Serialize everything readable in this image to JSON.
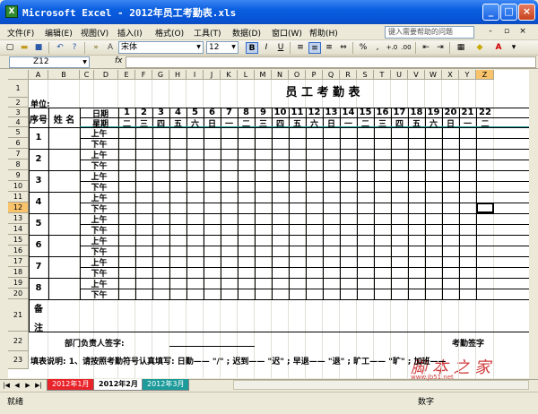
{
  "window": {
    "title": "Microsoft Excel - 2012年员工考勤表.xls",
    "app_icon": "X",
    "min": "_",
    "max": "□",
    "close": "×"
  },
  "menu": {
    "items": [
      "文件(F)",
      "编辑(E)",
      "视图(V)",
      "插入(I)",
      "格式(O)",
      "工具(T)",
      "数据(D)",
      "窗口(W)",
      "帮助(H)"
    ],
    "help_placeholder": "键入需要帮助的问题",
    "doc_controls": [
      "-",
      "▫",
      "×"
    ]
  },
  "toolbar": {
    "font": "宋体",
    "size": "12",
    "bold": "B",
    "italic": "I",
    "underline": "U",
    "percent": "%",
    "comma": ",",
    "font_color_glyph": "A"
  },
  "formula_bar": {
    "cell_ref": "Z12",
    "fx": "fx",
    "value": ""
  },
  "columns": [
    "A",
    "B",
    "C",
    "D",
    "E",
    "F",
    "G",
    "H",
    "I",
    "J",
    "K",
    "L",
    "M",
    "N",
    "O",
    "P",
    "Q",
    "R",
    "S",
    "T",
    "U",
    "V",
    "W",
    "X",
    "Y",
    "Z"
  ],
  "rows": [
    "1",
    "2",
    "3",
    "4",
    "5",
    "6",
    "7",
    "8",
    "9",
    "10",
    "11",
    "12",
    "13",
    "14",
    "15",
    "16",
    "17",
    "18",
    "19",
    "20",
    "21",
    "22",
    "23"
  ],
  "sheet": {
    "title": "员 工 考 勤 表",
    "unit_label": "单位:",
    "col_seq": "序号",
    "col_name": "姓  名",
    "date_label": "日期",
    "week_label": "星期",
    "days": [
      "1",
      "2",
      "3",
      "4",
      "5",
      "6",
      "7",
      "8",
      "9",
      "10",
      "11",
      "12",
      "13",
      "14",
      "15",
      "16",
      "17",
      "18",
      "19",
      "20",
      "21",
      "22"
    ],
    "weekdays": [
      "二",
      "三",
      "四",
      "五",
      "六",
      "日",
      "一",
      "二",
      "三",
      "四",
      "五",
      "六",
      "日",
      "一",
      "二",
      "三",
      "四",
      "五",
      "六",
      "日",
      "一",
      "二"
    ],
    "employees": [
      "1",
      "2",
      "3",
      "4",
      "5",
      "6",
      "7",
      "8"
    ],
    "am": "上午",
    "pm": "下午",
    "remark_top": "备",
    "remark_bottom": "注",
    "signature": "部门负责人签字:",
    "signature_right": "考勤签字",
    "instructions": "填表说明: 1、请按照考勤符号认真填写: 日勤—— \"/\" ; 迟到—— \"迟\" ; 早退—— \"退\" ; 旷工—— \"旷\" ; 加班——"
  },
  "tabs": {
    "nav": [
      "|◀",
      "◀",
      "▶",
      "▶|"
    ],
    "sheets": [
      {
        "label": "2012年1月",
        "color": "#e8232a"
      },
      {
        "label": "2012年2月",
        "color": "#ffffff"
      },
      {
        "label": "2012年3月",
        "color": "#1d9b9b"
      }
    ]
  },
  "status": {
    "left": "就绪",
    "right": "数字"
  },
  "watermark": {
    "text": "脚 本 之 家",
    "url": "www.jb51.net"
  }
}
